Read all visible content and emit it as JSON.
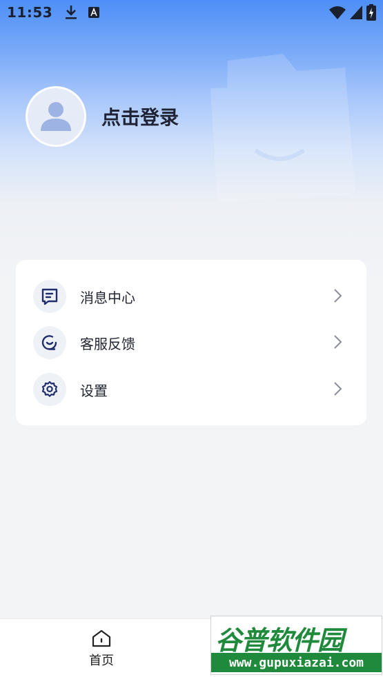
{
  "status_bar": {
    "time": "11:53",
    "icons_left": [
      "download-icon",
      "a-letter-notification-icon"
    ],
    "icons_right": [
      "wifi-icon",
      "cellular-signal-icon",
      "battery-charging-icon"
    ]
  },
  "profile": {
    "login_label": "点击登录",
    "avatar_icon": "user-silhouette-icon"
  },
  "menu": {
    "items": [
      {
        "label": "消息中心",
        "icon": "message-icon"
      },
      {
        "label": "客服反馈",
        "icon": "customer-service-icon"
      },
      {
        "label": "设置",
        "icon": "settings-gear-icon"
      }
    ]
  },
  "bottom_nav": {
    "items": [
      {
        "label": "首页",
        "icon": "home-icon"
      }
    ]
  },
  "watermark": {
    "title": "谷普软件园",
    "url": "www.gupuxiazai.com"
  },
  "colors": {
    "accent": "#4d8ff7",
    "icon_dark_navy": "#1f2d6b",
    "watermark_green": "#1f8a3c"
  }
}
